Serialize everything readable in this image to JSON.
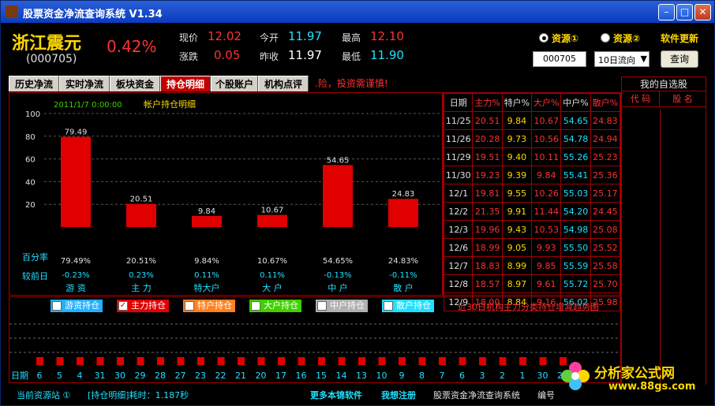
{
  "window": {
    "title": "股票资金净流查询系统  V1.34"
  },
  "stock": {
    "name": "浙江震元",
    "code": "(000705)",
    "change_pct": "0.42%"
  },
  "quotes": [
    {
      "label": "现价",
      "value": "12.02",
      "color": "red"
    },
    {
      "label": "涨跌",
      "value": "0.05",
      "color": "red"
    },
    {
      "label": "今开",
      "value": "11.97",
      "color": "cyan"
    },
    {
      "label": "昨收",
      "value": "11.97",
      "color": "white"
    },
    {
      "label": "最高",
      "value": "12.10",
      "color": "red"
    },
    {
      "label": "最低",
      "value": "11.90",
      "color": "cyan"
    }
  ],
  "source": {
    "opt1": "资源①",
    "opt2": "资源②",
    "update": "软件更新",
    "selected": "资源①"
  },
  "query": {
    "code": "000705",
    "period": "10日流向",
    "button": "查询"
  },
  "tabs": [
    "历史净流",
    "实时净流",
    "板块资金",
    "持仓明细",
    "个股账户",
    "机构点评"
  ],
  "active_tab": "持仓明细",
  "warning": ".险，投资需谨慎!",
  "chart_data": {
    "type": "bar",
    "title": "帐户持仓明细",
    "date": "2011/1/7 0:00:00",
    "ylim": [
      0,
      100
    ],
    "yticks": [
      100,
      80,
      60,
      40,
      20
    ],
    "categories": [
      "游 资",
      "主 力",
      "特大户",
      "大 户",
      "中 户",
      "散 户"
    ],
    "values": [
      79.49,
      20.51,
      9.84,
      10.67,
      54.65,
      24.83
    ],
    "pct_labels": [
      "79.49%",
      "20.51%",
      "9.84%",
      "10.67%",
      "54.65%",
      "24.83%"
    ],
    "change_labels": [
      "-0.23%",
      "0.23%",
      "0.11%",
      "0.11%",
      "-0.13%",
      "-0.11%"
    ],
    "row_label_pct": "百分率",
    "row_label_change": "较前日",
    "bar_color": "#e00000"
  },
  "table": {
    "headers": [
      "日期",
      "主力%",
      "特户%",
      "大户%",
      "中户%",
      "散户%"
    ],
    "rows": [
      [
        "11/25",
        "20.51",
        "9.84",
        "10.67",
        "54.65",
        "24.83"
      ],
      [
        "11/26",
        "20.28",
        "9.73",
        "10.56",
        "54.78",
        "24.94"
      ],
      [
        "11/29",
        "19.51",
        "9.40",
        "10.11",
        "55.26",
        "25.23"
      ],
      [
        "11/30",
        "19.23",
        "9.39",
        "9.84",
        "55.41",
        "25.36"
      ],
      [
        "12/1",
        "19.81",
        "9.55",
        "10.26",
        "55.03",
        "25.17"
      ],
      [
        "12/2",
        "21.35",
        "9.91",
        "11.44",
        "54.20",
        "24.45"
      ],
      [
        "12/3",
        "19.96",
        "9.43",
        "10.53",
        "54.98",
        "25.08"
      ],
      [
        "12/6",
        "18.99",
        "9.05",
        "9.93",
        "55.50",
        "25.52"
      ],
      [
        "12/7",
        "18.83",
        "8.99",
        "9.85",
        "55.59",
        "25.58"
      ],
      [
        "12/8",
        "18.57",
        "8.97",
        "9.61",
        "55.72",
        "25.70"
      ],
      [
        "12/9",
        "18.00",
        "8.84",
        "9.16",
        "56.02",
        "25.98"
      ]
    ]
  },
  "favorites": {
    "title": "我的自选股",
    "col1": "代 码",
    "col2": "股 名"
  },
  "filters": [
    {
      "label": "游资持仓",
      "color": "#20b0ff",
      "checked": false
    },
    {
      "label": "主力持仓",
      "color": "#e00000",
      "checked": true
    },
    {
      "label": "特户持仓",
      "color": "#ff8020",
      "checked": false
    },
    {
      "label": "大户持仓",
      "color": "#40d000",
      "checked": false
    },
    {
      "label": "中户持仓",
      "color": "#b0b0b0",
      "checked": false
    },
    {
      "label": "散户持仓",
      "color": "#20e0ff",
      "checked": false
    }
  ],
  "trend_title": "近30日机构主力分类持仓增减趋势图",
  "trend": {
    "date_label": "日期",
    "days": [
      "6",
      "5",
      "4",
      "31",
      "30",
      "29",
      "28",
      "27",
      "23",
      "22",
      "21",
      "20",
      "17",
      "16",
      "15",
      "14",
      "13",
      "10",
      "9",
      "8",
      "7",
      "6",
      "3",
      "2",
      "1",
      "30",
      "29"
    ]
  },
  "status": {
    "source": "当前资源站 ①",
    "info": "[持仓明细]耗时：1.187秒",
    "more": "更多本锦软件",
    "register": "我想注册",
    "app": "股票资金净流查询系统",
    "edit": "编号"
  },
  "watermark": {
    "text": "分析家公式网",
    "url": "www.88gs.com"
  }
}
